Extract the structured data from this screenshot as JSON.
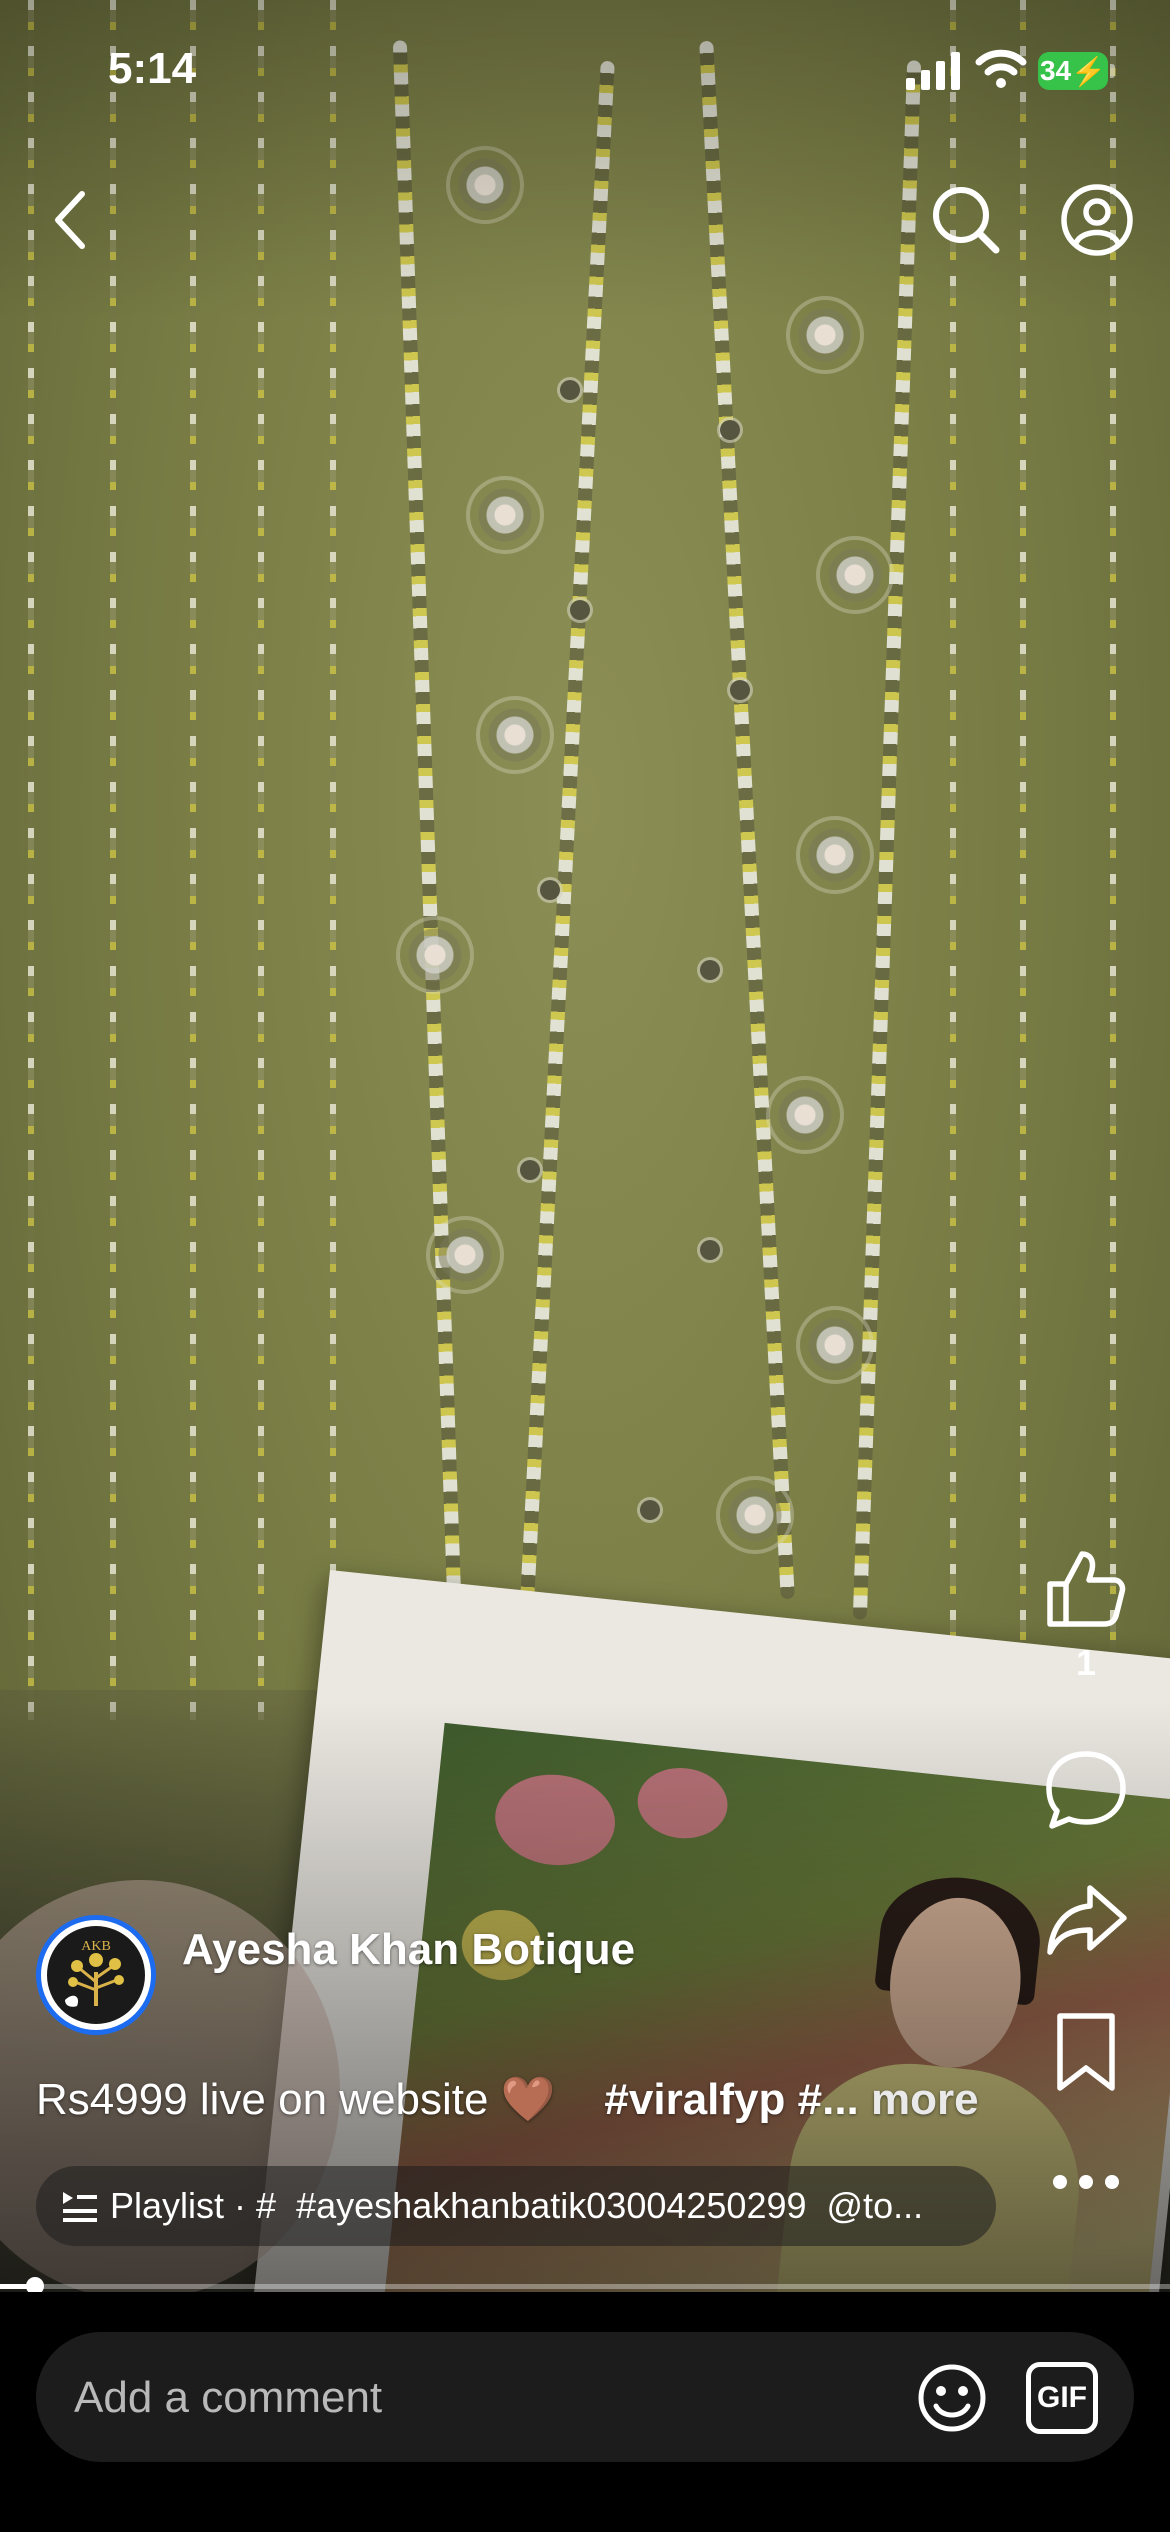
{
  "status_bar": {
    "time": "5:14",
    "battery_level": "34",
    "battery_color": "#37c24a",
    "icons": [
      "signal-icon",
      "wifi-icon",
      "battery-icon"
    ]
  },
  "top_controls": {
    "icons": [
      "back-icon",
      "search-icon",
      "profile-icon"
    ]
  },
  "actions": {
    "like_count": "1",
    "icons": [
      "like-icon",
      "comment-icon",
      "share-icon",
      "bookmark-icon",
      "more-icon"
    ]
  },
  "author": {
    "name": "Ayesha Khan Botique",
    "avatar_badge": "AKB",
    "avatar_ring_color": "#1d6cf0"
  },
  "caption": {
    "text": "Rs4999 live on website 🤎",
    "hashtag": "#viralfyp #...",
    "more_label": "more"
  },
  "playlist": {
    "label": "Playlist",
    "separator": "·",
    "hash": "#",
    "tag": "#ayeshakhanbatik03004250299",
    "mention": "@to..."
  },
  "progress": {
    "fraction": 0.03
  },
  "comment_bar": {
    "placeholder": "Add a comment",
    "gif_label": "GIF",
    "icons": [
      "emoji-icon",
      "gif-icon"
    ]
  }
}
